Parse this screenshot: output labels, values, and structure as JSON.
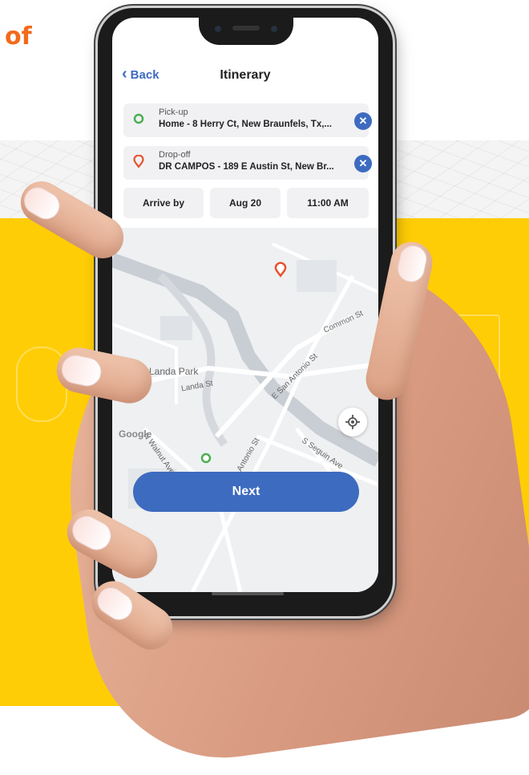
{
  "headline": "of",
  "header": {
    "back_label": "Back",
    "title": "Itinerary"
  },
  "pickup": {
    "label": "Pick-up",
    "address": "Home - 8 Herry Ct, New Braunfels, Tx,..."
  },
  "dropoff": {
    "label": "Drop-off",
    "address": "DR CAMPOS - 189 E Austin St, New Br..."
  },
  "schedule": {
    "mode": "Arrive by",
    "date": "Aug 20",
    "time": "11:00 AM"
  },
  "map": {
    "labels": {
      "landa_park": "Landa Park",
      "landa_st": "Landa St",
      "san_antonio_st_1": "E San Antonio St",
      "san_antonio_st_2": "San Antonio St",
      "common_st": "Common St",
      "walnut_ave": "N Walnut Ave",
      "seguin_ave": "S Seguin Ave"
    },
    "attribution": "Google"
  },
  "next_label": "Next",
  "colors": {
    "accent": "#3d6bbf",
    "pickup_pin": "#4caf50",
    "dropoff_pin": "#e8502a",
    "headline": "#f26a1b",
    "yellow_bg": "#ffcd05"
  },
  "icons": {
    "back": "chevron-left-icon",
    "clear": "close-icon",
    "pickup": "location-pin-icon",
    "dropoff": "location-pin-icon",
    "locate": "my-location-icon"
  }
}
